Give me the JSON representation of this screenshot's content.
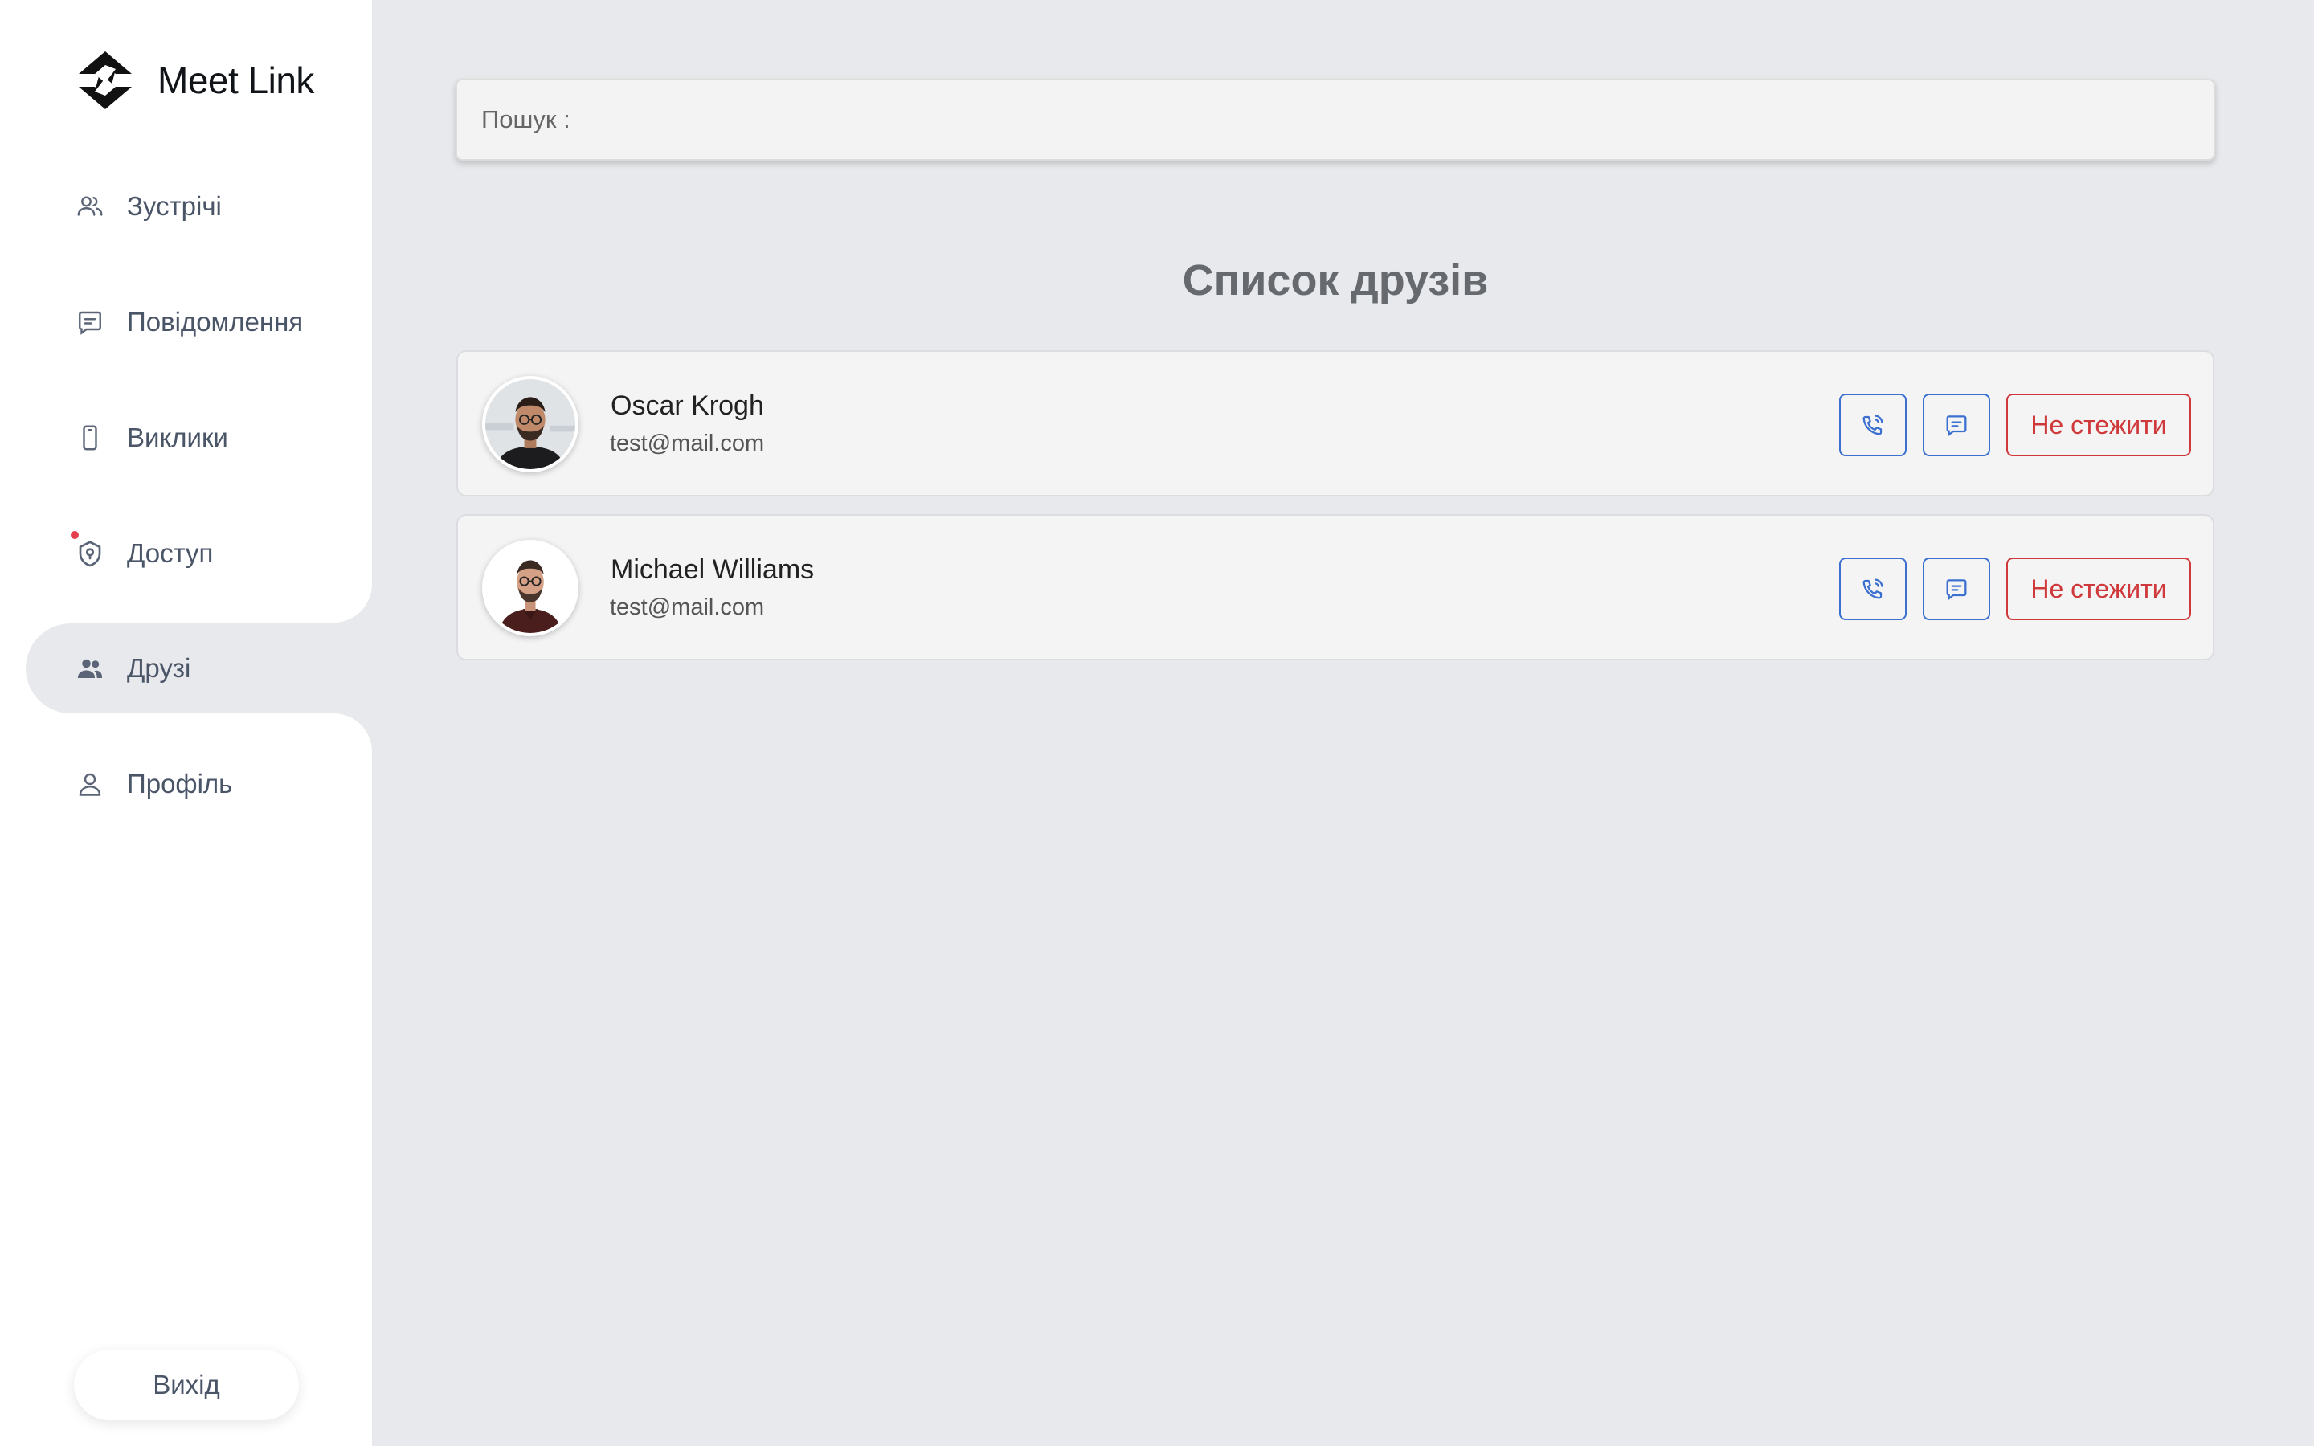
{
  "app": {
    "name": "Meet Link"
  },
  "sidebar": {
    "items": [
      {
        "label": "Зустрічі",
        "icon": "users-icon"
      },
      {
        "label": "Повідомлення",
        "icon": "message-icon"
      },
      {
        "label": "Виклики",
        "icon": "phone-icon"
      },
      {
        "label": "Доступ",
        "icon": "shield-icon",
        "notification": true
      },
      {
        "label": "Друзі",
        "icon": "friends-icon",
        "active": true
      },
      {
        "label": "Профіль",
        "icon": "user-icon"
      }
    ],
    "logout_label": "Вихід"
  },
  "search": {
    "label": "Пошук :",
    "value": ""
  },
  "main": {
    "title": "Список друзів",
    "friends": [
      {
        "name": "Oscar Krogh",
        "email": "test@mail.com",
        "unfollow_label": "Не стежити"
      },
      {
        "name": "Michael Williams",
        "email": "test@mail.com",
        "unfollow_label": "Не стежити"
      }
    ]
  },
  "colors": {
    "background": "#e8e9ec",
    "sidebar": "#ffffff",
    "accent_blue": "#3b6fd0",
    "danger_red": "#d0393b",
    "notification_dot": "#e53e4e"
  }
}
